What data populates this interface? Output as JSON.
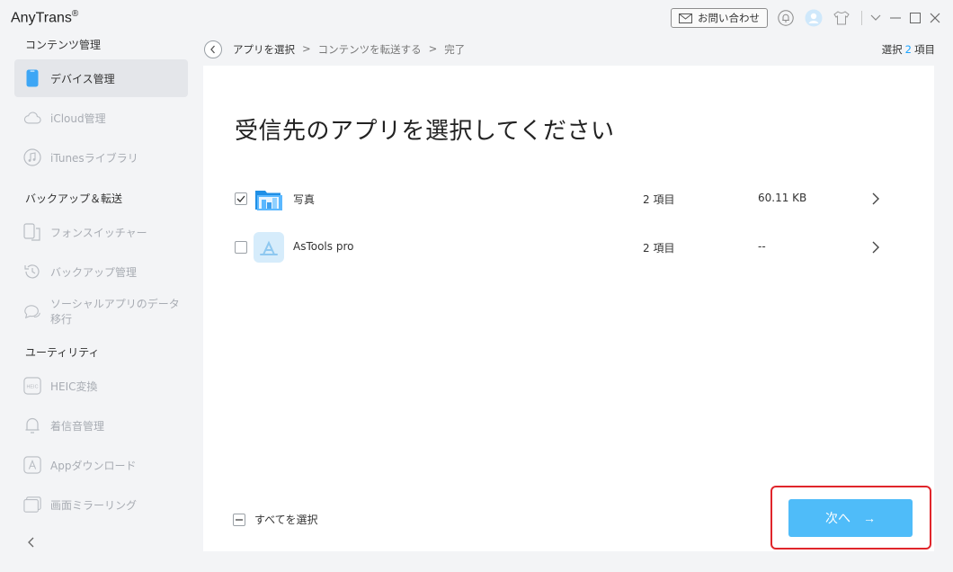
{
  "window": {
    "app_title": "AnyTrans",
    "trademark": "®",
    "contact_label": "お問い合わせ"
  },
  "sidebar": {
    "sections": [
      {
        "title": "コンテンツ管理"
      },
      {
        "title": "バックアップ＆転送"
      },
      {
        "title": "ユーティリティ"
      }
    ],
    "items": [
      {
        "label": "デバイス管理",
        "icon": "phone-icon",
        "active": true
      },
      {
        "label": "iCloud管理",
        "icon": "cloud-icon"
      },
      {
        "label": "iTunesライブラリ",
        "icon": "music-icon"
      },
      {
        "label": "フォンスイッチャー",
        "icon": "phone-switch-icon"
      },
      {
        "label": "バックアップ管理",
        "icon": "backup-clock-icon"
      },
      {
        "label": "ソーシャルアプリのデータ移行",
        "icon": "chat-icon"
      },
      {
        "label": "HEIC変換",
        "icon": "heic-icon"
      },
      {
        "label": "着信音管理",
        "icon": "bell-icon"
      },
      {
        "label": "Appダウンロード",
        "icon": "app-store-icon"
      },
      {
        "label": "画面ミラーリング",
        "icon": "mirror-icon"
      }
    ]
  },
  "breadcrumb": {
    "steps": [
      "アプリを選択",
      "コンテンツを転送する",
      "完了"
    ],
    "separator": ">"
  },
  "selection": {
    "prefix": "選択",
    "count": "2",
    "suffix": "項目"
  },
  "main": {
    "title": "受信先のアプリを選択してください",
    "apps": [
      {
        "name": "写真",
        "items": "2 項目",
        "size": "60.11 KB",
        "checked": true,
        "icon": "photos-app-icon"
      },
      {
        "name": "AsTools pro",
        "items": "2 項目",
        "size": "--",
        "checked": false,
        "icon": "app-store-app-icon"
      }
    ],
    "select_all_label": "すべてを選択",
    "next_label": "次へ",
    "next_arrow": "→"
  },
  "colors": {
    "accent": "#1aa3ff",
    "next_button": "#4fbcf9",
    "highlight_border": "#e0252b"
  }
}
